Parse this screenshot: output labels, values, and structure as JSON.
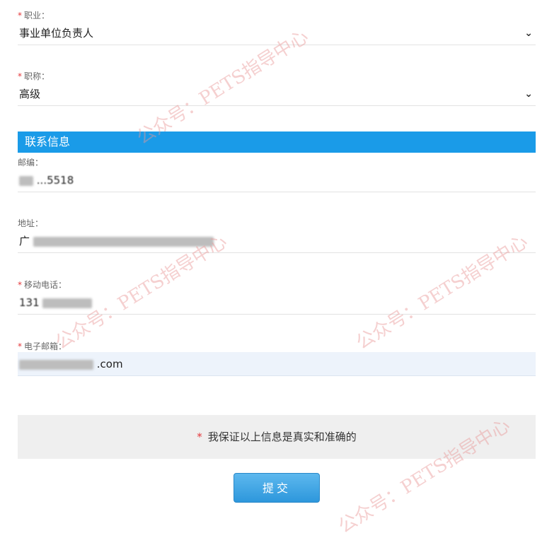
{
  "occupation": {
    "required": "*",
    "label": "职业：",
    "value": "事业单位负责人",
    "chevron": "⌄"
  },
  "title": {
    "required": "*",
    "label": "职称：",
    "value": "高级",
    "chevron": "⌄"
  },
  "contact_section": {
    "header": "联系信息"
  },
  "postcode": {
    "label": "邮编：",
    "value_visible": "...5518"
  },
  "address": {
    "label": "地址：",
    "value_visible": "广"
  },
  "mobile": {
    "required": "*",
    "label": "移动电话：",
    "value_visible": "131"
  },
  "email": {
    "required": "*",
    "label": "电子邮箱：",
    "value_suffix": ".com"
  },
  "guarantee": {
    "required": "*",
    "text": "我保证以上信息是真实和准确的"
  },
  "submit": {
    "label": "提交"
  },
  "watermark": {
    "text": "公众号：PETS指导中心"
  }
}
